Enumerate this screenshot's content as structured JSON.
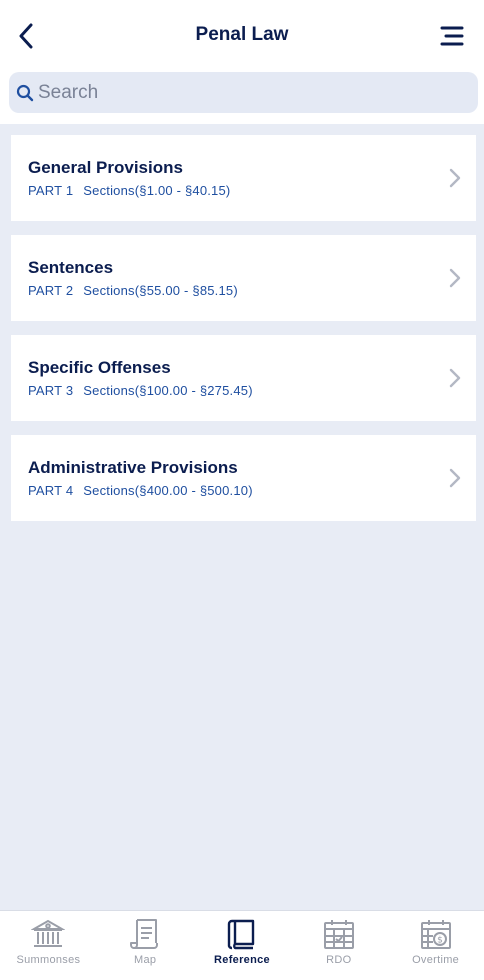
{
  "header": {
    "title": "Penal Law"
  },
  "search": {
    "placeholder": "Search",
    "value": ""
  },
  "sections": [
    {
      "title": "General Provisions",
      "part": "PART 1",
      "range": "Sections(§1.00 - §40.15)"
    },
    {
      "title": "Sentences",
      "part": "PART 2",
      "range": "Sections(§55.00 - §85.15)"
    },
    {
      "title": "Specific Offenses",
      "part": "PART 3",
      "range": "Sections(§100.00 - §275.45)"
    },
    {
      "title": "Administrative Provisions",
      "part": "PART 4",
      "range": "Sections(§400.00 - §500.10)"
    }
  ],
  "tabbar": {
    "tabs": [
      {
        "label": "Summonses",
        "icon": "courthouse-icon"
      },
      {
        "label": "Map",
        "icon": "scroll-map-icon"
      },
      {
        "label": "Reference",
        "icon": "book-icon"
      },
      {
        "label": "RDO",
        "icon": "calendar-check-icon"
      },
      {
        "label": "Overtime",
        "icon": "calendar-dollar-icon"
      }
    ],
    "active": "Reference"
  },
  "colors": {
    "primary": "#0b1d4f",
    "link": "#1f4fa0",
    "background": "#e8ecf5",
    "inactive": "#9a9ea8"
  }
}
